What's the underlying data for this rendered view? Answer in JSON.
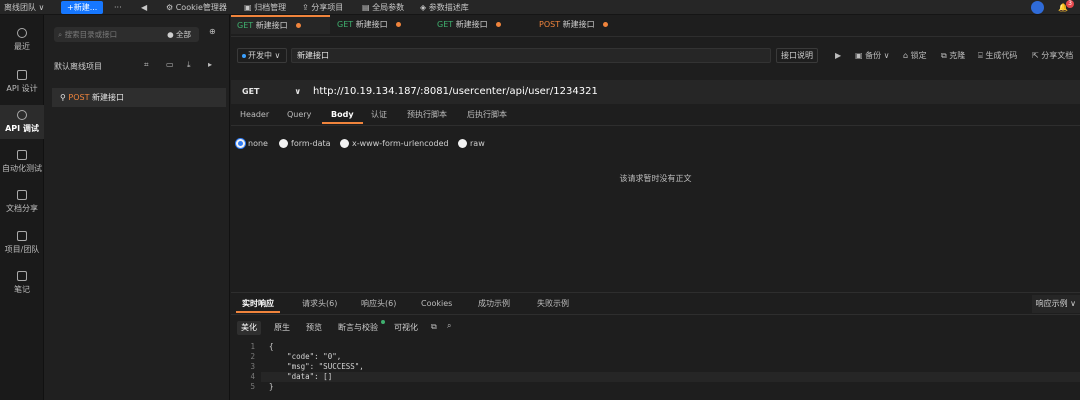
{
  "topbar": {
    "team": "离线团队 ∨",
    "new_button": "+新建...",
    "more": "···",
    "back": "◀",
    "items": [
      "Cookie管理器",
      "归档管理",
      "分享项目",
      "全局参数",
      "参数描述库"
    ],
    "badge": "3"
  },
  "leftnav": {
    "items": [
      "最近",
      "API 设计",
      "API 调试",
      "自动化测试",
      "文档分享",
      "项目/团队",
      "笔记"
    ]
  },
  "tree": {
    "search_placeholder": "搜索目录或接口",
    "scope": "● 全部",
    "project_name": "默认离线项目",
    "item_method": "POST",
    "item_name": "新建接口"
  },
  "tabs": [
    {
      "method": "GET",
      "name": "新建接口"
    },
    {
      "method": "GET",
      "name": "新建接口"
    },
    {
      "method": "GET",
      "name": "新建接口"
    },
    {
      "method": "POST",
      "name": "新建接口"
    }
  ],
  "request": {
    "env": "开发中",
    "name": "新建接口",
    "doc_button": "接口说明",
    "tools": [
      "▶",
      "备份 ∨",
      "锁定",
      "克隆",
      "生成代码",
      "分享文档"
    ],
    "method": "GET",
    "url": "http://10.19.134.187/:8081/usercenter/api/user/1234321"
  },
  "subtabs": [
    "Header",
    "Query",
    "Body",
    "认证",
    "预执行脚本",
    "后执行脚本"
  ],
  "body_types": [
    "none",
    "form-data",
    "x-www-form-urlencoded",
    "raw"
  ],
  "body_empty": "该请求暂时没有正文",
  "response": {
    "tabs": [
      "实时响应",
      "请求头(6)",
      "响应头(6)",
      "Cookies",
      "成功示例",
      "失败示例"
    ],
    "example_dropdown": "响应示例 ∨",
    "subtabs": [
      "美化",
      "原生",
      "预览",
      "断言与校验",
      "可视化"
    ],
    "lines": [
      "{",
      "    \"code\": \"0\",",
      "    \"msg\": \"SUCCESS\",",
      "    \"data\": []",
      "}"
    ]
  }
}
